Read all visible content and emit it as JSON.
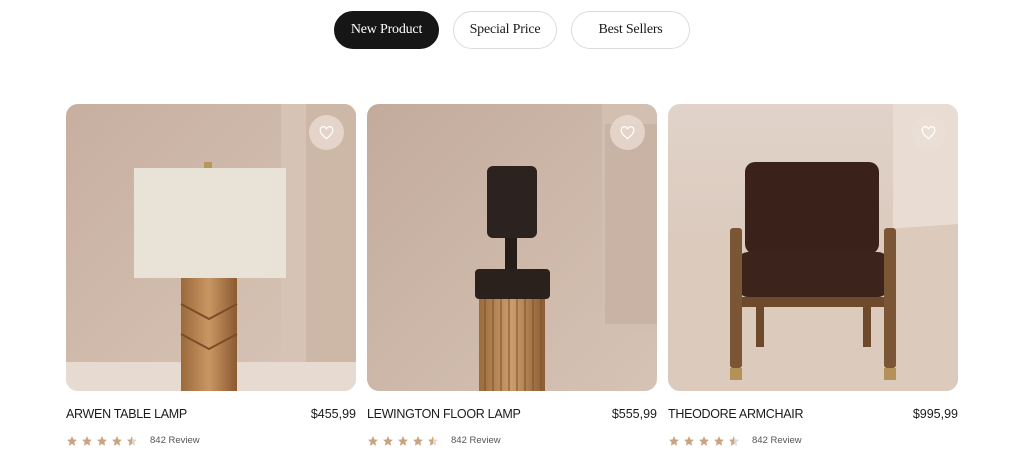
{
  "tabs": [
    {
      "label": "New Product",
      "active": true
    },
    {
      "label": "Special Price",
      "active": false
    },
    {
      "label": "Best Sellers",
      "active": false
    }
  ],
  "products": [
    {
      "name": "ARWEN TABLE LAMP",
      "price": "$455,99",
      "rating": 4.5,
      "reviews": "842 Review",
      "favorite_icon": "heart-outline-icon"
    },
    {
      "name": "LEWINGTON FLOOR LAMP",
      "price": "$555,99",
      "rating": 4.5,
      "reviews": "842 Review",
      "favorite_icon": "heart-outline-icon"
    },
    {
      "name": "THEODORE ARMCHAIR",
      "price": "$995,99",
      "rating": 4.5,
      "reviews": "842 Review",
      "favorite_icon": "heart-outline-icon"
    }
  ],
  "colors": {
    "active_tab": "#161616",
    "star": "#c9a47e",
    "star_empty": "#e2d6c8"
  }
}
